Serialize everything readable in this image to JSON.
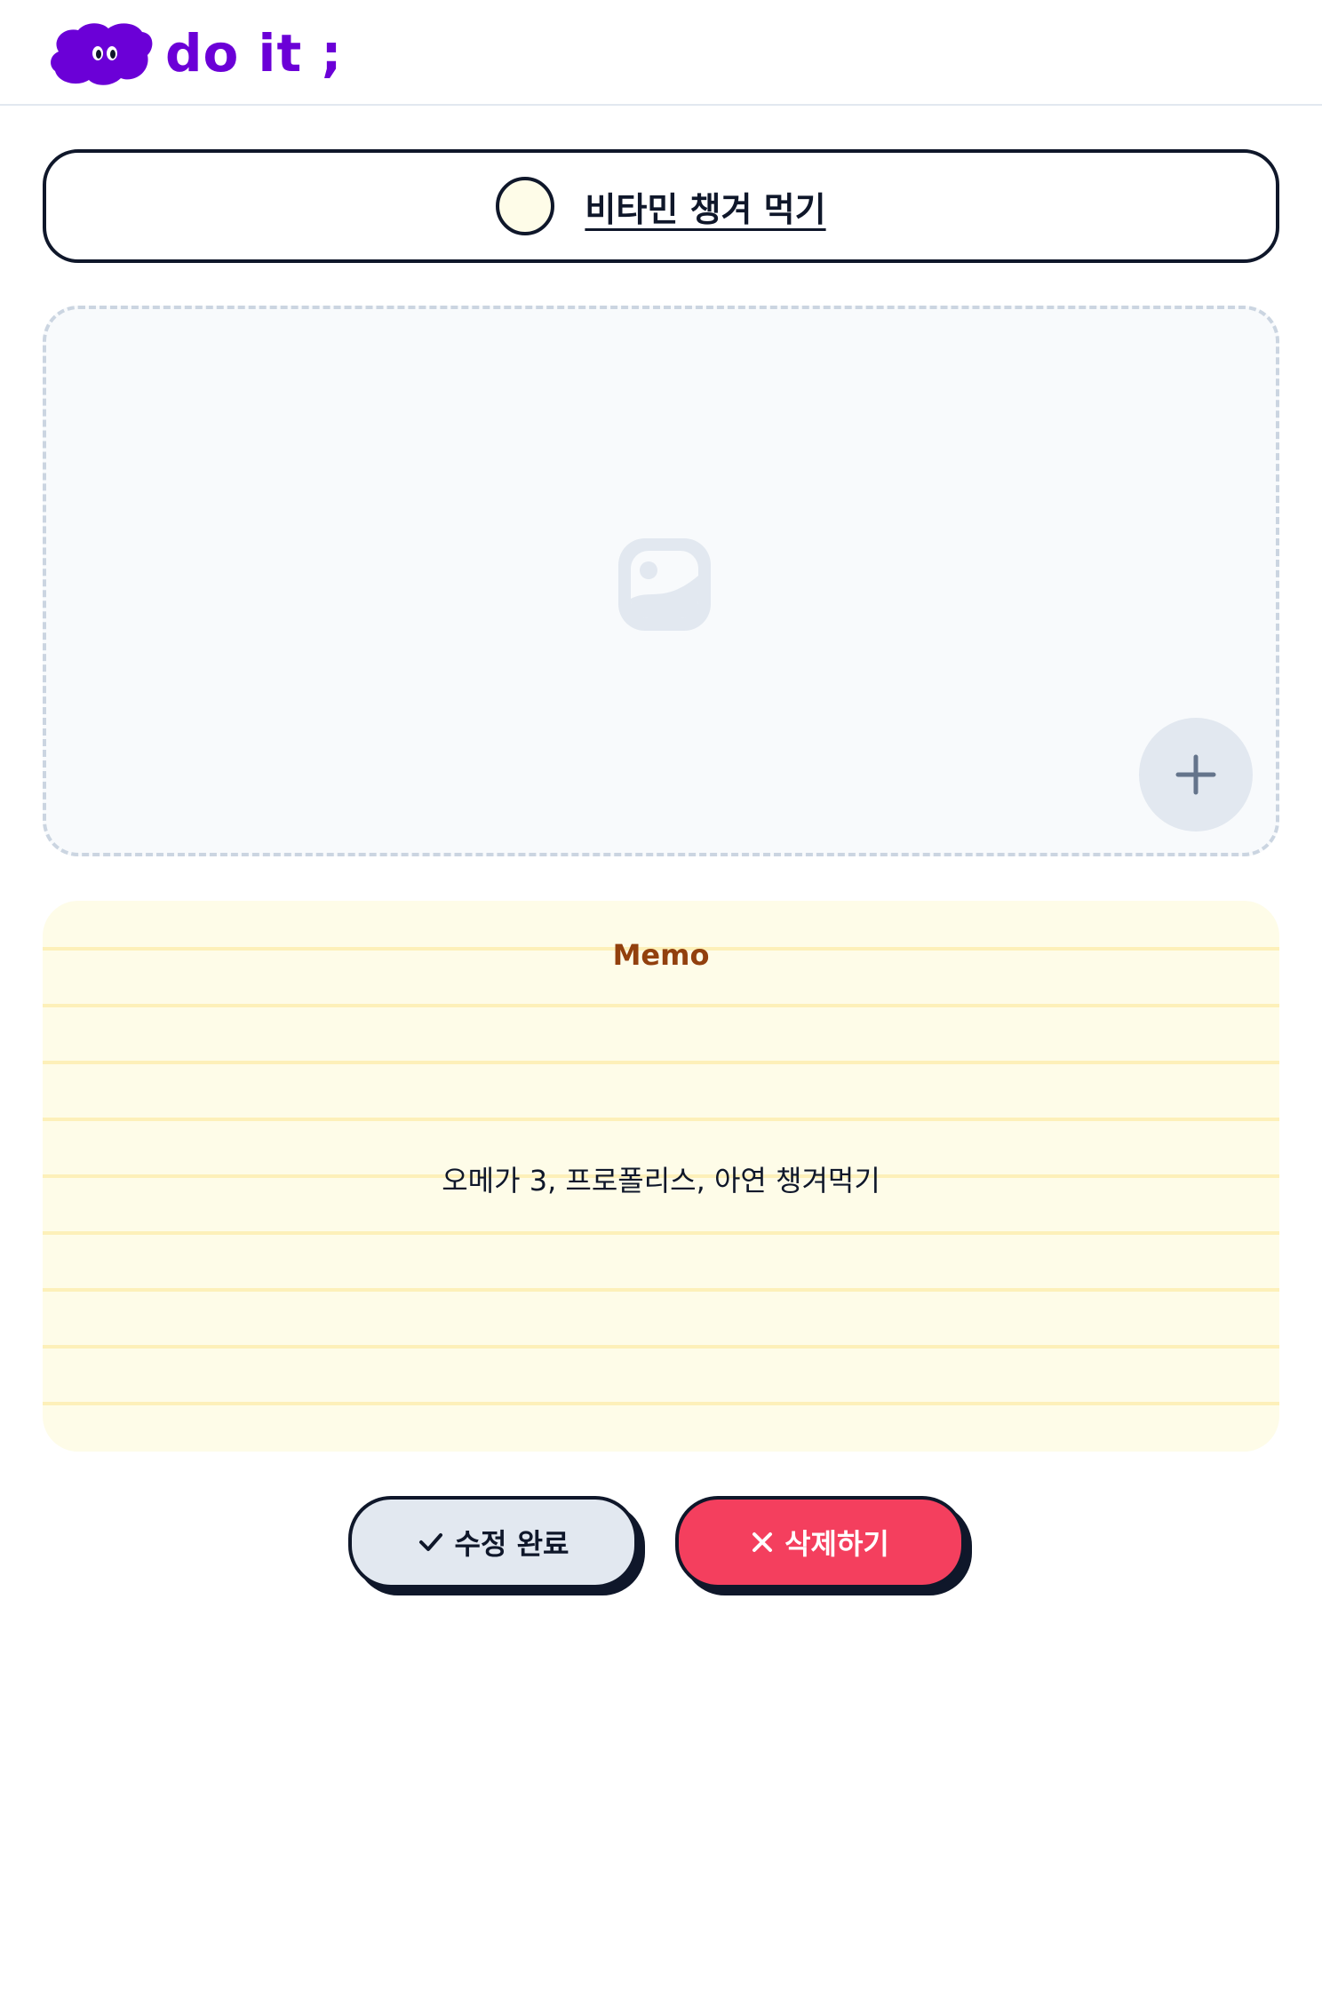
{
  "header": {
    "logo_text": "do it ;",
    "brand_color": "#6b00d7"
  },
  "todo": {
    "title": "비타민 챙겨 먹기",
    "completed": false
  },
  "image": {
    "placeholder_icon": "image-icon",
    "add_icon": "plus-icon"
  },
  "memo": {
    "title": "Memo",
    "text": "오메가 3, 프로폴리스, 아연 챙겨먹기"
  },
  "actions": {
    "save_label": "수정 완료",
    "save_icon": "check-icon",
    "delete_label": "삭제하기",
    "delete_icon": "close-icon",
    "delete_color": "#f43f5e"
  }
}
